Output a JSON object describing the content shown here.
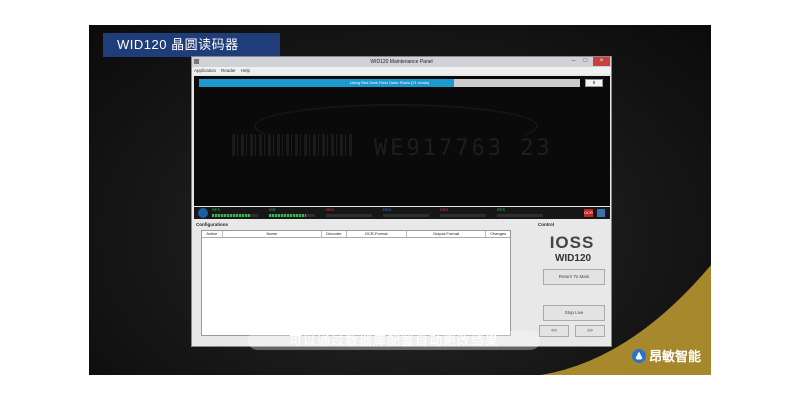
{
  "banner": {
    "title": "WID120 晶圆读码器"
  },
  "subtitle": "可以通过数据库配置自动更改结果",
  "brand": {
    "name": "昂敏智能"
  },
  "window": {
    "title": "WID120 Maintenance Panel",
    "controls": {
      "minimize": "–",
      "maximize": "□",
      "close": "×"
    },
    "menu": [
      "Application",
      "Reader",
      "Help"
    ]
  },
  "camera": {
    "status_text": "Using Red Dark Field Outer Rows (21 reads)",
    "status_progress": 0.67,
    "button_label": "x",
    "decoded_text": "WE917763 23"
  },
  "meters": [
    {
      "label": "RFS",
      "color": "#27c24c",
      "level": 0.85
    },
    {
      "label": "ISR",
      "color": "#27c24c",
      "level": 0.8
    },
    {
      "label": "RED",
      "color": "#e23c3c",
      "level": 0.0
    },
    {
      "label": "RED",
      "color": "#3d6fe3",
      "level": 0.0
    },
    {
      "label": "RED",
      "color": "#e23c3c",
      "level": 0.0
    },
    {
      "label": "RFS",
      "color": "#27c24c",
      "level": 0.0
    }
  ],
  "meter_badge": "OCR",
  "configurations": {
    "title": "Configurations",
    "columns": [
      "Active",
      "Name",
      "Decoder",
      "OCR-Format",
      "Output-Format",
      "Changes"
    ]
  },
  "control": {
    "title": "Control",
    "logo_text": "IOSS",
    "model_text": "WID120",
    "buttons": [
      "Return To Main",
      "Stop Live"
    ],
    "nav_prev": "<<",
    "nav_next": ">>"
  },
  "colors": {
    "banner": "#1f3d78",
    "accent_gold": "#b8952f",
    "status_blue": "#1a9ad1"
  }
}
